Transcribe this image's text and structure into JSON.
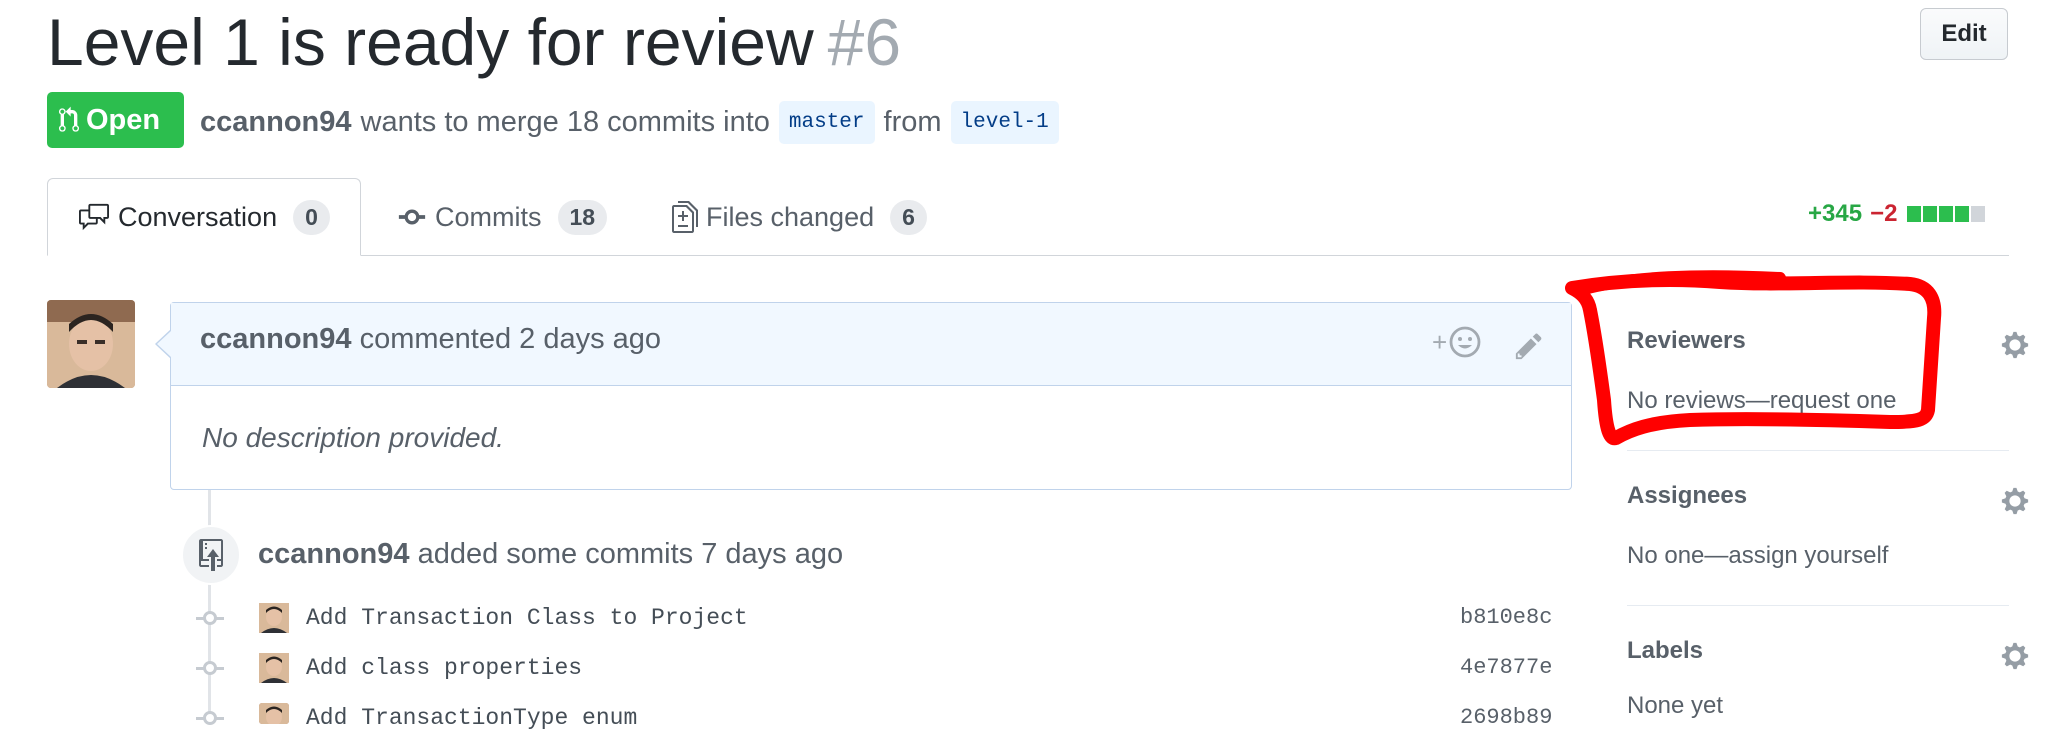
{
  "header": {
    "title": "Level 1 is ready for review",
    "number": "#6",
    "edit_label": "Edit"
  },
  "state": {
    "label": "Open",
    "color": "#2cbe4e"
  },
  "meta": {
    "author": "ccannon94",
    "text_merge": "wants to merge 18 commits into",
    "base_branch": "master",
    "text_from": "from",
    "head_branch": "level-1"
  },
  "tabs": [
    {
      "label": "Conversation",
      "count": "0",
      "icon": "comment-discussion-icon"
    },
    {
      "label": "Commits",
      "count": "18",
      "icon": "git-commit-icon"
    },
    {
      "label": "Files changed",
      "count": "6",
      "icon": "diff-icon"
    }
  ],
  "diffstat": {
    "additions": "+345",
    "deletions": "−2"
  },
  "comment": {
    "author": "ccannon94",
    "action": "commented 2 days ago",
    "reaction_label": "+",
    "body": "No description provided."
  },
  "push_event": {
    "author": "ccannon94",
    "action": "added some commits 7 days ago"
  },
  "commits": [
    {
      "message": "Add Transaction Class to Project",
      "sha": "b810e8c"
    },
    {
      "message": "Add class properties",
      "sha": "4e7877e"
    },
    {
      "message": "Add TransactionType enum",
      "sha": "2698b89"
    }
  ],
  "sidebar": {
    "reviewers_title": "Reviewers",
    "reviewers_value": "No reviews—request one",
    "assignees_title": "Assignees",
    "assignees_value": "No one—assign yourself",
    "labels_title": "Labels",
    "labels_value": "None yet"
  },
  "colors": {
    "annotation": "#ff0000",
    "added": "#28a745",
    "deleted": "#cb2431"
  }
}
